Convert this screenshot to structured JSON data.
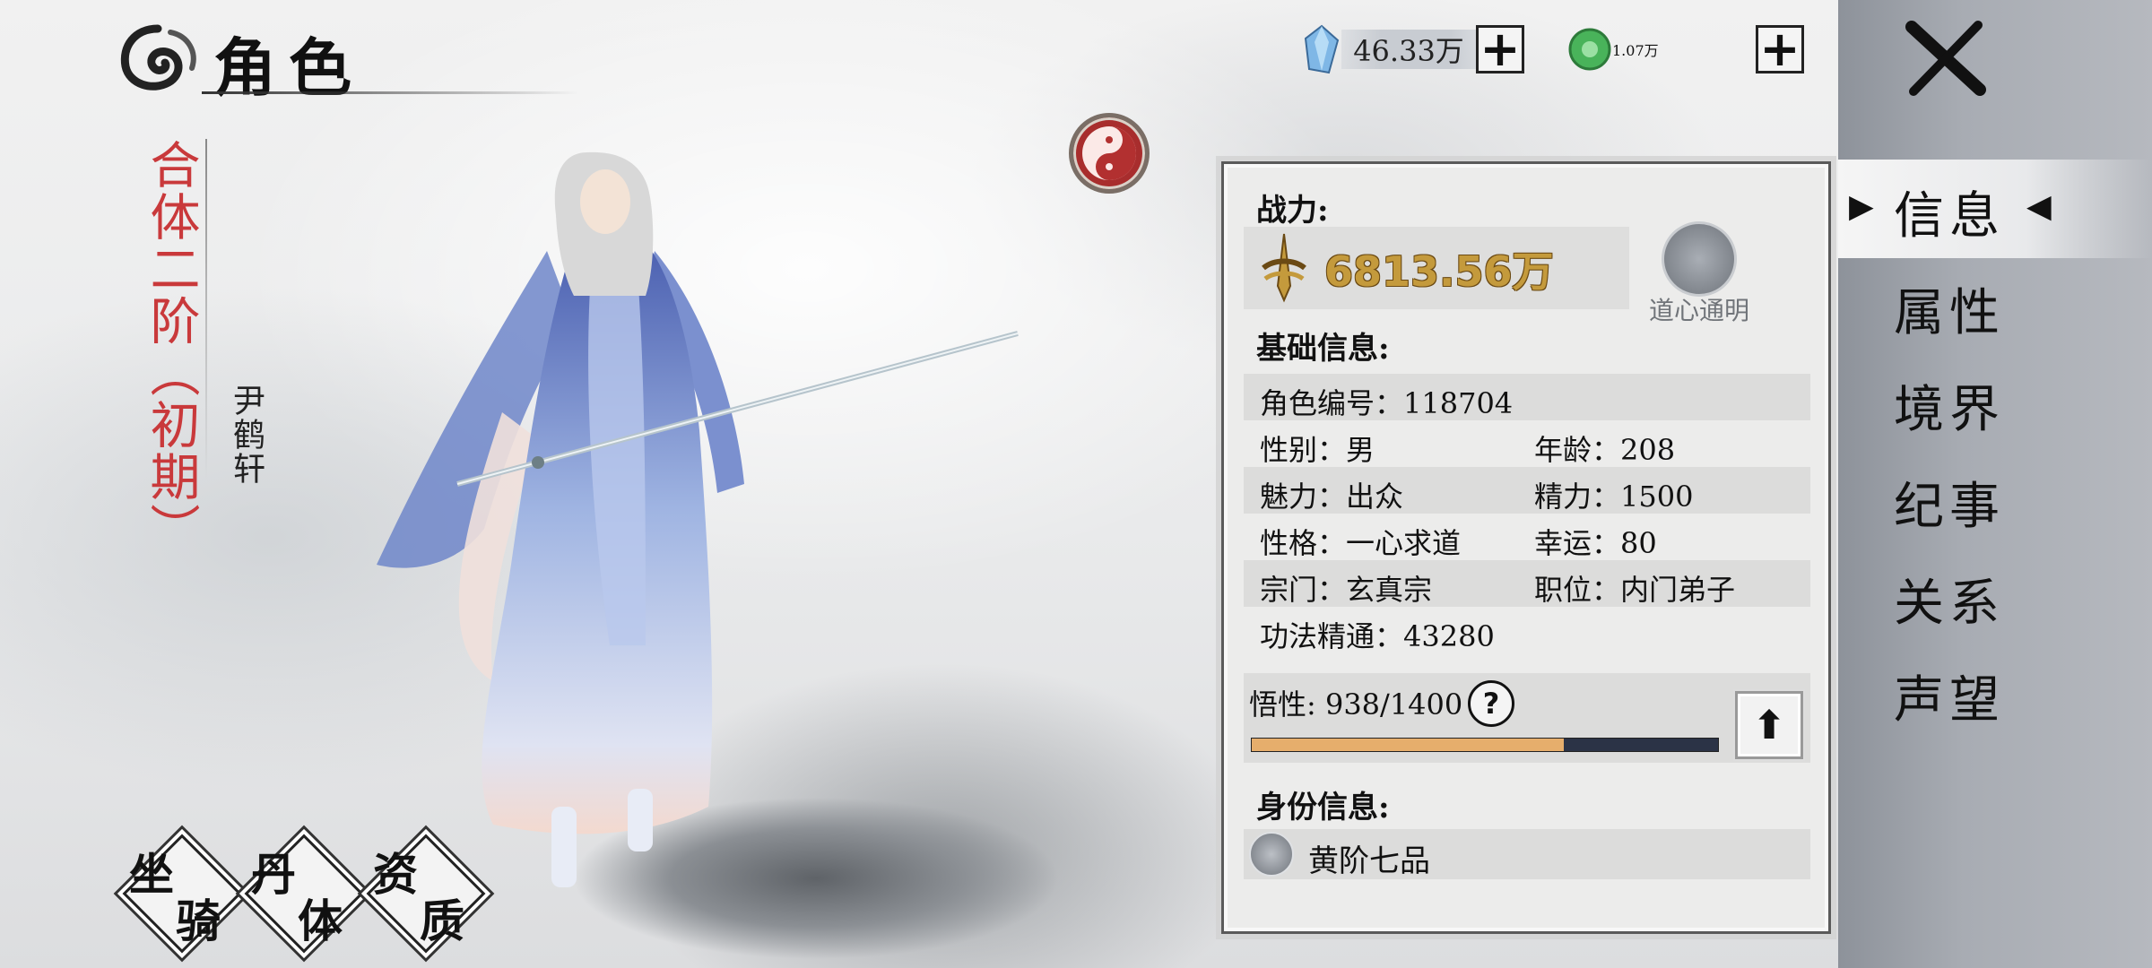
{
  "header": {
    "title": "角色"
  },
  "character": {
    "realm": "合体二阶（初期）",
    "name": "尹鹤轩"
  },
  "currencies": [
    {
      "icon": "crystal-icon",
      "value": "46.33万"
    },
    {
      "icon": "jade-coin-icon",
      "value": "1.07万"
    }
  ],
  "nav": {
    "items": [
      "信息",
      "属性",
      "境界",
      "纪事",
      "关系",
      "声望"
    ],
    "active": "信息"
  },
  "panel": {
    "power_title": "战力:",
    "power_value": "6813.56万",
    "daoxin_label": "道心通明",
    "basic_title": "基础信息:",
    "rows": {
      "role_id": "角色编号：118704",
      "gender": "性别：男",
      "age": "年龄：208",
      "charm": "魅力：出众",
      "energy": "精力：1500",
      "personality": "性格：一心求道",
      "luck": "幸运：80",
      "sect": "宗门：玄真宗",
      "position": "职位：内门弟子",
      "mastery": "功法精通：43280"
    },
    "wuxing_label": "悟性: 938/1400",
    "wuxing_fraction": 0.67,
    "help_symbol": "?",
    "identity_title": "身份信息:",
    "identity_rank": "黄阶七品"
  },
  "bottom_buttons": [
    {
      "a": "坐",
      "b": "骑"
    },
    {
      "a": "丹",
      "b": "体"
    },
    {
      "a": "资",
      "b": "质"
    }
  ],
  "colors": {
    "realm_red": "#c9393b",
    "power_gold": "#c49a3c",
    "bar_fill": "#e6ae6c",
    "bar_track": "#2b3346"
  }
}
